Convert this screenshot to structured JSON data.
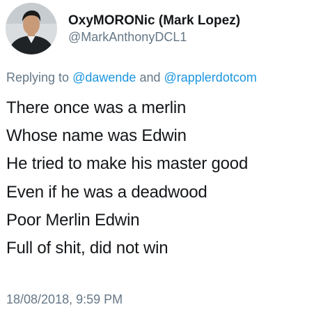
{
  "tweet": {
    "author": {
      "display_name": "OxyMORONic (Mark Lopez)",
      "handle": "@MarkAnthonyDCL1"
    },
    "reply": {
      "prefix": "Replying to",
      "mention_1": "@dawende",
      "conjunction": "and",
      "mention_2": "@rapplerdotcom"
    },
    "lines": [
      "There once was a merlin",
      "Whose name was Edwin",
      "He tried to make his master good",
      "Even if he was a deadwood",
      "Poor Merlin Edwin",
      "Full of shit, did not win"
    ],
    "timestamp": "18/08/2018, 9:59 PM"
  },
  "colors": {
    "text": "#14171a",
    "muted": "#657786",
    "link": "#1b95e0",
    "background": "#ffffff"
  }
}
